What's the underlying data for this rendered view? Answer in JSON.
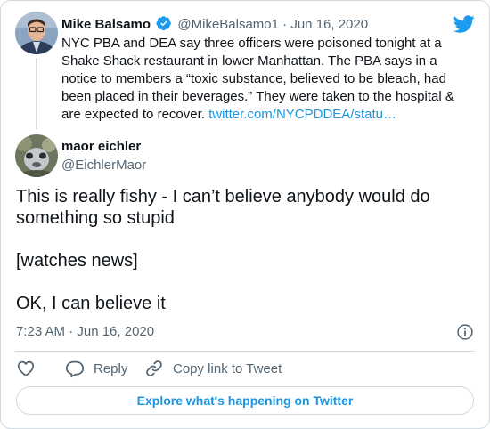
{
  "parent_tweet": {
    "author_name": "Mike Balsamo",
    "handle": "@MikeBalsamo1",
    "separator": "·",
    "date": "Jun 16, 2020",
    "text": "NYC PBA and DEA say three officers were poisoned tonight at a Shake Shack restaurant in lower Manhattan. The PBA says in a notice to members a “toxic substance, believed to be bleach, had been placed in their beverages.” They were taken to the hospital & are expected to recover. ",
    "link_text": "twitter.com/NYCPDDEA/statu…"
  },
  "tweet": {
    "author_name": "maor eichler",
    "handle": "@EichlerMaor",
    "lines": [
      "This is really fishy - I can’t believe anybody would do something so stupid",
      "[watches news]",
      "OK, I can believe it"
    ],
    "timestamp": "7:23 AM · Jun 16, 2020"
  },
  "actions": {
    "reply_label": "Reply",
    "copy_link_label": "Copy link to Tweet"
  },
  "explore_label": "Explore what's happening on Twitter",
  "colors": {
    "twitter_blue": "#1d9bf0",
    "link_blue": "#1b95e0",
    "muted_text": "#536471",
    "border": "#cfd9de"
  },
  "icons": [
    "twitter-bird-icon",
    "verified-badge-icon",
    "info-icon",
    "heart-icon",
    "reply-icon",
    "link-icon"
  ]
}
